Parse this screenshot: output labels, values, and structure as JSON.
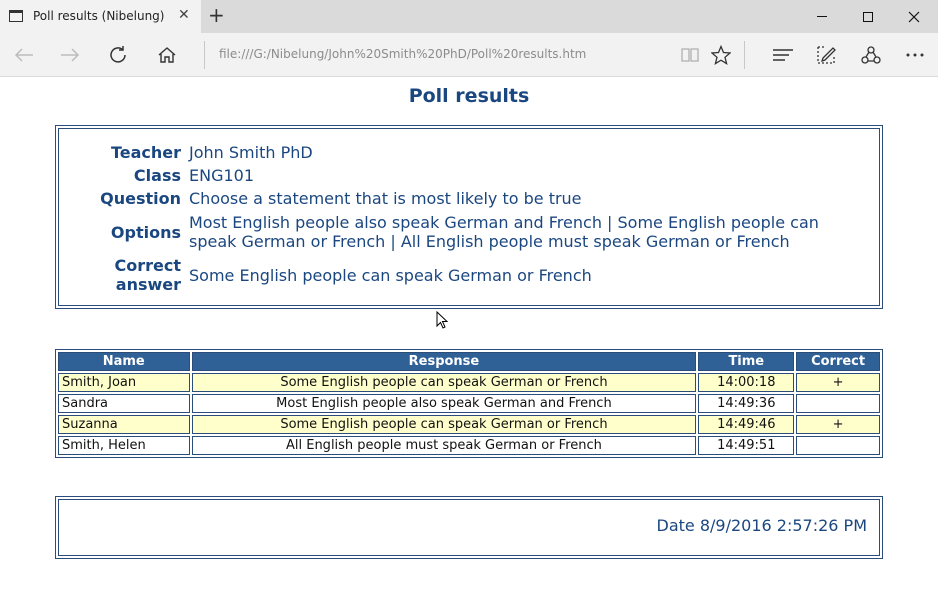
{
  "browser": {
    "tab_title": "Poll results (Nibelung)",
    "tab_close": "✕",
    "new_tab": "+",
    "address": "file:///G:/Nibelung/John%20Smith%20PhD/Poll%20results.htm",
    "icons": [
      "back-icon",
      "forward-icon",
      "refresh-icon",
      "home-icon",
      "reading-view-icon",
      "favorite-star-icon",
      "hub-icon",
      "web-note-icon",
      "share-icon",
      "more-icon"
    ]
  },
  "page": {
    "title": "Poll results",
    "info": {
      "teacher_label": "Teacher",
      "teacher": "John Smith PhD",
      "class_label": "Class",
      "class": "ENG101",
      "question_label": "Question",
      "question": "Choose a statement that is most likely to be true",
      "options_label": "Options",
      "options": "Most English people also speak German and French | Some English people can speak German or French | All English people must speak German or French",
      "correct_label_1": "Correct",
      "correct_label_2": "answer",
      "correct_answer": "Some English people can speak German or French"
    },
    "table": {
      "headers": [
        "Name",
        "Response",
        "Time",
        "Correct"
      ],
      "rows": [
        {
          "name": "Smith, Joan",
          "response": "Some English people can speak German or French",
          "time": "14:00:18",
          "correct": "+"
        },
        {
          "name": "Sandra",
          "response": "Most English people also speak German and French",
          "time": "14:49:36",
          "correct": ""
        },
        {
          "name": "Suzanna",
          "response": "Some English people can speak German or French",
          "time": "14:49:46",
          "correct": "+"
        },
        {
          "name": "Smith, Helen",
          "response": "All English people must speak German or French",
          "time": "14:49:51",
          "correct": ""
        }
      ]
    },
    "date": "Date 8/9/2016 2:57:26 PM"
  },
  "colors": {
    "text_blue": "#1b4780",
    "header_blue": "#2f6096",
    "highlight_row": "#ffffcc"
  }
}
